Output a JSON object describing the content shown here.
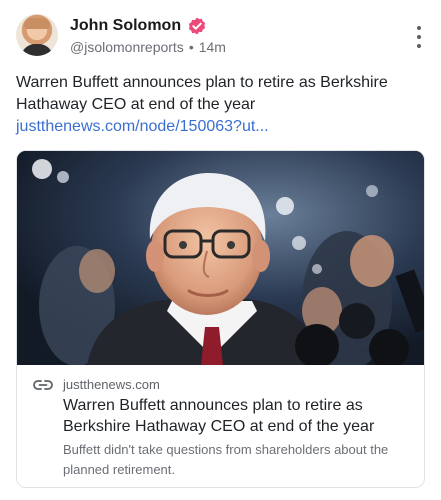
{
  "author": {
    "name": "John Solomon",
    "handle": "@jsolomonreports",
    "separator": "•",
    "time": "14m",
    "verified": true
  },
  "post": {
    "text": "Warren Buffett announces plan to retire as Berkshire Hathaway CEO at end of the year ",
    "link_text": "justthenews.com/node/150063?ut..."
  },
  "card": {
    "domain": "justthenews.com",
    "title": "Warren Buffett announces plan to retire as Berkshire Hathaway CEO at end of the year",
    "description": "Buffett didn't take questions from shareholders about the planned retirement."
  },
  "icons": {
    "verified": "verified-badge-icon",
    "menu": "more-vertical-icon",
    "link": "link-icon"
  },
  "colors": {
    "link": "#3b6fd1",
    "verified": "#ec4b7a"
  }
}
